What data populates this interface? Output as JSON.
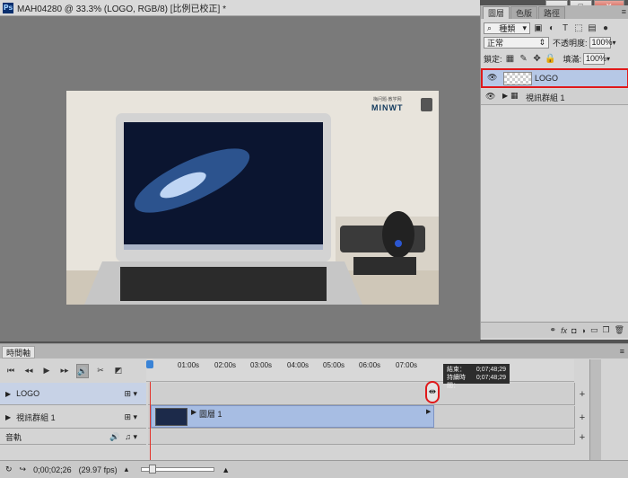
{
  "document": {
    "title": "MAH04280 @ 33.3% (LOGO, RGB/8) [比例已校正] *",
    "app_icon": "Ps",
    "watermark_brand": "MINWT",
    "watermark_tagline": "梅问题·教学网"
  },
  "window_buttons": {
    "minimize": "—",
    "maximize": "□",
    "close": "✕"
  },
  "layers_panel": {
    "tabs": [
      "圖層",
      "色版",
      "路徑"
    ],
    "active_tab": "圖層",
    "menu_icon": "≡",
    "filter": {
      "label": "種類",
      "icon": "search-icon"
    },
    "blend_mode": "正常",
    "opacity_label": "不透明度:",
    "opacity_value": "100%",
    "lock_label": "鎖定:",
    "fill_label": "填滿:",
    "fill_value": "100%",
    "layers": [
      {
        "name": "LOGO",
        "visible": true,
        "selected": true
      },
      {
        "name": "視訊群組 1",
        "visible": true,
        "selected": false
      }
    ],
    "bottom_icons": [
      "link-icon",
      "fx-icon",
      "mask-icon",
      "adjustment-icon",
      "group-folder-icon",
      "new-layer-icon",
      "trash-icon"
    ]
  },
  "timeline": {
    "tab_label": "時間軸",
    "menu_icon": "≡",
    "ruler_labels": [
      "01:00s",
      "02:00s",
      "03:00s",
      "04:00s",
      "05:00s",
      "06:00s",
      "07:00s"
    ],
    "tracks": [
      {
        "name": "LOGO",
        "type": "layer"
      },
      {
        "name": "視訊群組 1",
        "type": "video-group",
        "clip_label": "圖層 1"
      },
      {
        "name": "音軌",
        "type": "audio"
      }
    ],
    "tooltip": {
      "end_label": "結束：",
      "end_value": "0;07;48;29",
      "duration_label": "持續時間：",
      "duration_value": "0;07;48;29"
    },
    "current_time": "0;00;02;26",
    "fps": "(29.97 fps)"
  },
  "colors": {
    "selection_blue": "#b6c8e6",
    "highlight_red": "#e0191b",
    "playhead_red": "#e3332a",
    "clip_blue": "#a7bde3"
  }
}
